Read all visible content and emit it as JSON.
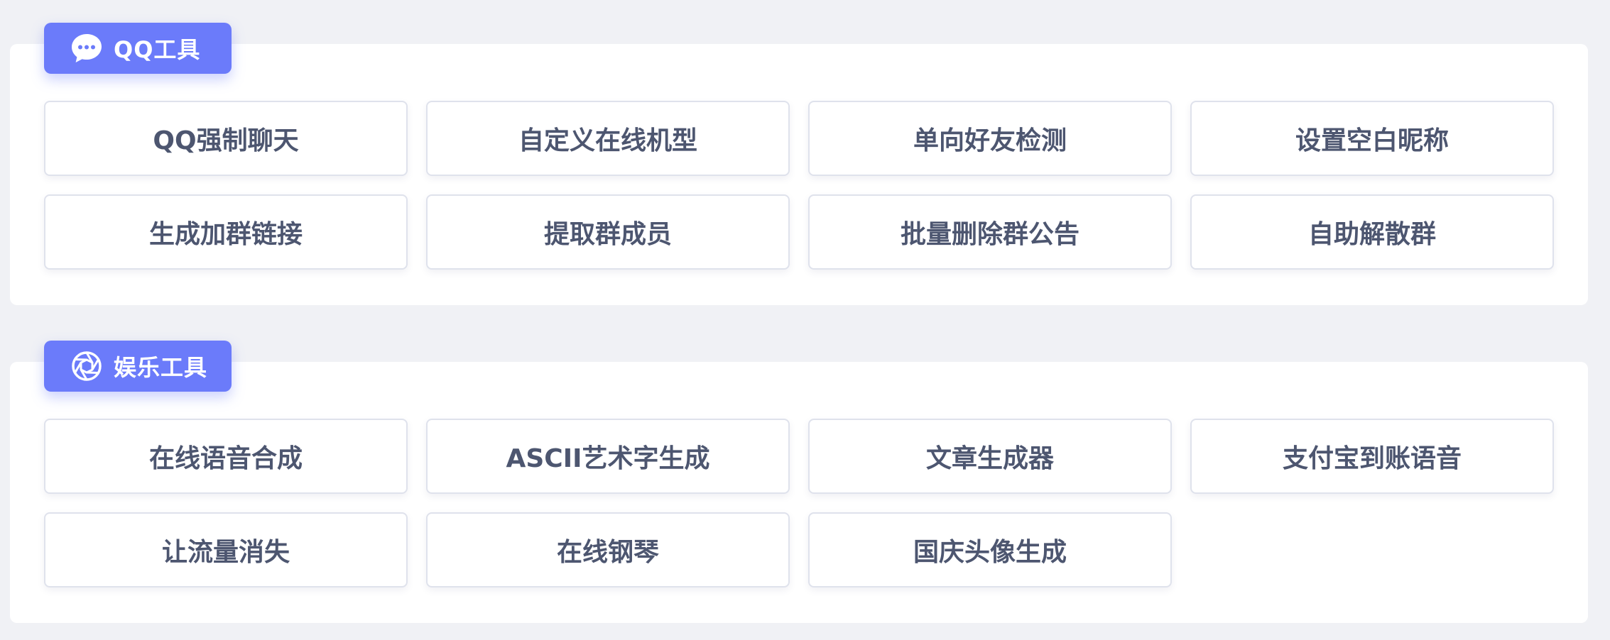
{
  "sections": [
    {
      "title": "QQ工具",
      "icon": "chat-bubble-icon",
      "items": [
        "QQ强制聊天",
        "自定义在线机型",
        "单向好友检测",
        "设置空白昵称",
        "生成加群链接",
        "提取群成员",
        "批量删除群公告",
        "自助解散群"
      ]
    },
    {
      "title": "娱乐工具",
      "icon": "aperture-icon",
      "items": [
        "在线语音合成",
        "ASCII艺术字生成",
        "文章生成器",
        "支付宝到账语音",
        "让流量消失",
        "在线钢琴",
        "国庆头像生成"
      ]
    }
  ],
  "colors": {
    "accent": "#6b7bfa",
    "text": "#4d5670",
    "background": "#f0f1f5"
  }
}
